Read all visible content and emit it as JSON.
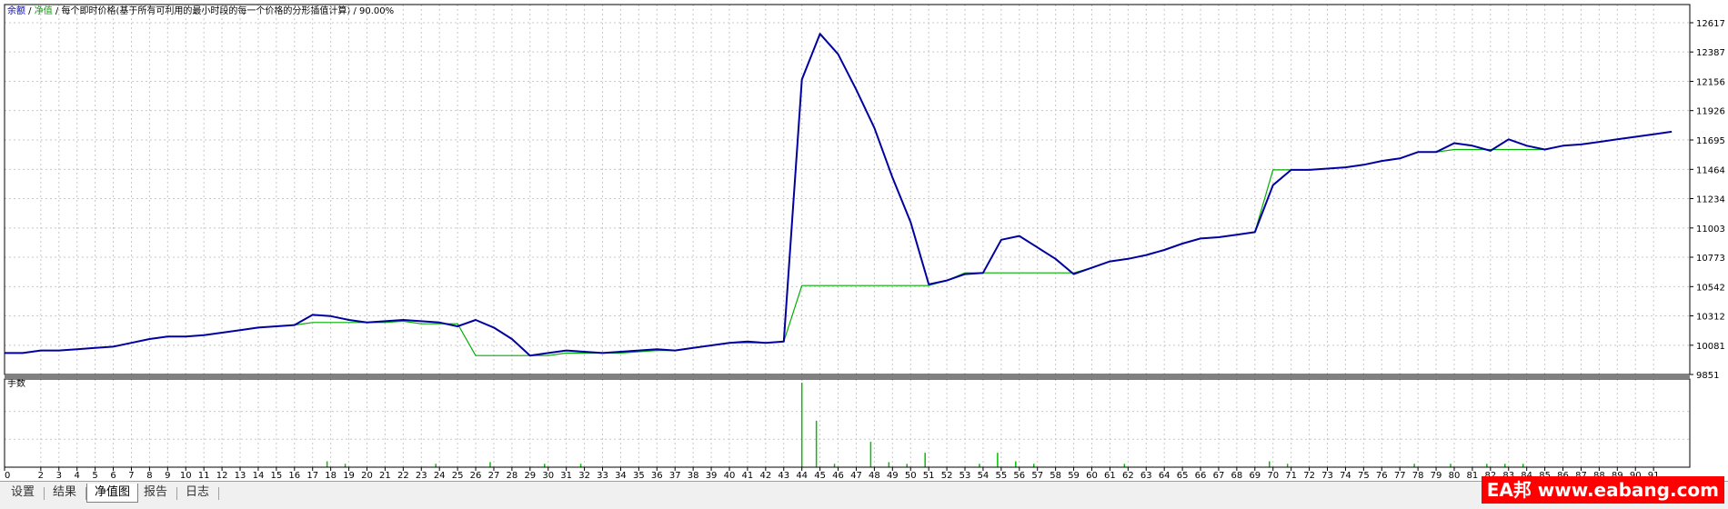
{
  "header": {
    "balance_label": "余额",
    "sep1": " / ",
    "equity_label": "净值",
    "sep2": " / ",
    "model_desc": "每个即时价格(基于所有可利用的最小时段的每一个价格的分形插值计算)",
    "sep3": " / ",
    "quality": "90.00%"
  },
  "tabs": [
    {
      "label": "设置"
    },
    {
      "label": "结果"
    },
    {
      "label": "净值图"
    },
    {
      "label": "报告"
    },
    {
      "label": "日志"
    }
  ],
  "watermark": "EA邦 www.eabang.com",
  "colors": {
    "equity": "#0000a0",
    "balance": "#00b000",
    "volume": "#00c000",
    "grid": "#c8c8c8",
    "separator": "#808080"
  },
  "chart_data": [
    {
      "type": "line",
      "title": "",
      "ylim": [
        9851,
        12617
      ],
      "y_ticks": [
        12617,
        12387,
        12156,
        11926,
        11695,
        11464,
        11234,
        11003,
        10773,
        10542,
        10312,
        10081,
        9851
      ],
      "x_ticks": [
        0,
        2,
        3,
        4,
        5,
        6,
        7,
        8,
        9,
        10,
        11,
        12,
        13,
        14,
        15,
        16,
        17,
        18,
        19,
        20,
        21,
        22,
        23,
        24,
        25,
        26,
        27,
        28,
        29,
        30,
        31,
        32,
        33,
        34,
        35,
        36,
        37,
        38,
        39,
        40,
        41,
        42,
        43,
        44,
        45,
        46,
        47,
        48,
        49,
        50,
        51,
        52,
        53,
        54,
        55,
        56,
        57,
        58,
        59,
        60,
        61,
        62,
        63,
        64,
        65,
        66,
        67,
        68,
        69,
        70,
        71,
        72,
        73,
        74,
        75,
        76,
        77,
        78,
        79,
        80,
        81,
        82,
        83,
        84,
        85,
        86,
        87,
        88,
        89,
        90,
        91
      ],
      "x_tick_labels": [
        "0",
        "2",
        "3",
        "4",
        "5",
        "6",
        "7",
        "8",
        "9",
        "10",
        "11",
        "12",
        "13",
        "14",
        "15",
        "16",
        "17",
        "18",
        "19",
        "20",
        "21",
        "22",
        "23",
        "24",
        "25",
        "26",
        "27",
        "28",
        "29",
        "30",
        "31",
        "32",
        "33",
        "34",
        "35",
        "36",
        "37",
        "38",
        "39",
        "40",
        "41",
        "42",
        "43",
        "44",
        "45",
        "46",
        "47",
        "48",
        "49",
        "50",
        "51",
        "52",
        "53",
        "54",
        "55",
        "56",
        "57",
        "58",
        "59",
        "60",
        "61",
        "62",
        "63",
        "64",
        "65",
        "66",
        "67",
        "68",
        "69",
        "70",
        "71",
        "72",
        "73",
        "74",
        "75",
        "76",
        "77",
        "78",
        "79",
        "80",
        "81",
        "82",
        "83",
        "84",
        "85",
        "86",
        "87",
        "88",
        "89",
        "90",
        "91"
      ],
      "xlim": [
        0,
        93
      ],
      "series": [
        {
          "name": "净值",
          "color": "#0000a0",
          "points": [
            [
              0,
              10020
            ],
            [
              1,
              10020
            ],
            [
              2,
              10040
            ],
            [
              3,
              10040
            ],
            [
              4,
              10050
            ],
            [
              5,
              10060
            ],
            [
              6,
              10070
            ],
            [
              7,
              10100
            ],
            [
              8,
              10130
            ],
            [
              9,
              10150
            ],
            [
              10,
              10150
            ],
            [
              11,
              10160
            ],
            [
              12,
              10180
            ],
            [
              13,
              10200
            ],
            [
              14,
              10220
            ],
            [
              15,
              10230
            ],
            [
              16,
              10240
            ],
            [
              17,
              10320
            ],
            [
              18,
              10310
            ],
            [
              19,
              10280
            ],
            [
              20,
              10260
            ],
            [
              21,
              10270
            ],
            [
              22,
              10280
            ],
            [
              23,
              10270
            ],
            [
              24,
              10260
            ],
            [
              25,
              10230
            ],
            [
              26,
              10280
            ],
            [
              27,
              10220
            ],
            [
              28,
              10130
            ],
            [
              29,
              10000
            ],
            [
              30,
              10020
            ],
            [
              31,
              10040
            ],
            [
              32,
              10030
            ],
            [
              33,
              10020
            ],
            [
              34,
              10030
            ],
            [
              35,
              10040
            ],
            [
              36,
              10050
            ],
            [
              37,
              10040
            ],
            [
              38,
              10060
            ],
            [
              39,
              10080
            ],
            [
              40,
              10100
            ],
            [
              41,
              10110
            ],
            [
              42,
              10100
            ],
            [
              43,
              10110
            ],
            [
              44,
              12170
            ],
            [
              45,
              12530
            ],
            [
              46,
              12370
            ],
            [
              47,
              12090
            ],
            [
              48,
              11790
            ],
            [
              49,
              11400
            ],
            [
              50,
              11050
            ],
            [
              51,
              10560
            ],
            [
              52,
              10590
            ],
            [
              53,
              10640
            ],
            [
              54,
              10650
            ],
            [
              55,
              10910
            ],
            [
              56,
              10940
            ],
            [
              57,
              10850
            ],
            [
              58,
              10760
            ],
            [
              59,
              10640
            ],
            [
              60,
              10690
            ],
            [
              61,
              10740
            ],
            [
              62,
              10760
            ],
            [
              63,
              10790
            ],
            [
              64,
              10830
            ],
            [
              65,
              10880
            ],
            [
              66,
              10920
            ],
            [
              67,
              10930
            ],
            [
              68,
              10950
            ],
            [
              69,
              10970
            ],
            [
              70,
              11340
            ],
            [
              71,
              11460
            ],
            [
              72,
              11460
            ],
            [
              73,
              11470
            ],
            [
              74,
              11480
            ],
            [
              75,
              11500
            ],
            [
              76,
              11530
            ],
            [
              77,
              11550
            ],
            [
              78,
              11600
            ],
            [
              79,
              11600
            ],
            [
              80,
              11670
            ],
            [
              81,
              11650
            ],
            [
              82,
              11610
            ],
            [
              83,
              11700
            ],
            [
              84,
              11650
            ],
            [
              85,
              11620
            ],
            [
              86,
              11650
            ],
            [
              87,
              11660
            ],
            [
              88,
              11680
            ],
            [
              89,
              11700
            ],
            [
              90,
              11720
            ],
            [
              91,
              11740
            ],
            [
              92,
              11760
            ]
          ]
        },
        {
          "name": "余额",
          "color": "#00b000",
          "points": [
            [
              0,
              10020
            ],
            [
              1,
              10020
            ],
            [
              2,
              10040
            ],
            [
              3,
              10040
            ],
            [
              4,
              10050
            ],
            [
              5,
              10060
            ],
            [
              6,
              10070
            ],
            [
              7,
              10100
            ],
            [
              8,
              10130
            ],
            [
              9,
              10150
            ],
            [
              10,
              10150
            ],
            [
              11,
              10160
            ],
            [
              12,
              10180
            ],
            [
              13,
              10200
            ],
            [
              14,
              10220
            ],
            [
              15,
              10230
            ],
            [
              16,
              10240
            ],
            [
              17,
              10260
            ],
            [
              18,
              10260
            ],
            [
              19,
              10260
            ],
            [
              20,
              10260
            ],
            [
              21,
              10260
            ],
            [
              22,
              10270
            ],
            [
              23,
              10250
            ],
            [
              24,
              10250
            ],
            [
              25,
              10250
            ],
            [
              26,
              10000
            ],
            [
              27,
              10000
            ],
            [
              28,
              10000
            ],
            [
              29,
              10000
            ],
            [
              30,
              10000
            ],
            [
              31,
              10020
            ],
            [
              32,
              10020
            ],
            [
              33,
              10020
            ],
            [
              34,
              10020
            ],
            [
              35,
              10030
            ],
            [
              36,
              10040
            ],
            [
              37,
              10040
            ],
            [
              38,
              10060
            ],
            [
              39,
              10080
            ],
            [
              40,
              10100
            ],
            [
              41,
              10100
            ],
            [
              42,
              10100
            ],
            [
              43,
              10110
            ],
            [
              44,
              10550
            ],
            [
              45,
              10550
            ],
            [
              46,
              10550
            ],
            [
              47,
              10550
            ],
            [
              48,
              10550
            ],
            [
              49,
              10550
            ],
            [
              50,
              10550
            ],
            [
              51,
              10550
            ],
            [
              52,
              10590
            ],
            [
              53,
              10650
            ],
            [
              54,
              10650
            ],
            [
              55,
              10650
            ],
            [
              56,
              10650
            ],
            [
              57,
              10650
            ],
            [
              58,
              10650
            ],
            [
              59,
              10650
            ],
            [
              60,
              10690
            ],
            [
              61,
              10740
            ],
            [
              62,
              10760
            ],
            [
              63,
              10790
            ],
            [
              64,
              10830
            ],
            [
              65,
              10880
            ],
            [
              66,
              10920
            ],
            [
              67,
              10930
            ],
            [
              68,
              10950
            ],
            [
              69,
              10970
            ],
            [
              70,
              11460
            ],
            [
              71,
              11460
            ],
            [
              72,
              11460
            ],
            [
              73,
              11470
            ],
            [
              74,
              11480
            ],
            [
              75,
              11500
            ],
            [
              76,
              11530
            ],
            [
              77,
              11550
            ],
            [
              78,
              11600
            ],
            [
              79,
              11600
            ],
            [
              80,
              11620
            ],
            [
              81,
              11620
            ],
            [
              82,
              11620
            ],
            [
              83,
              11620
            ],
            [
              84,
              11620
            ],
            [
              85,
              11620
            ],
            [
              86,
              11650
            ],
            [
              87,
              11660
            ],
            [
              88,
              11680
            ],
            [
              89,
              11700
            ],
            [
              90,
              11720
            ],
            [
              91,
              11740
            ],
            [
              92,
              11760
            ]
          ]
        }
      ]
    },
    {
      "type": "bar",
      "title": "手数",
      "ylim": [
        0,
        1
      ],
      "xlim": [
        0,
        93
      ],
      "bars": [
        [
          17.8,
          0.07
        ],
        [
          18.8,
          0.04
        ],
        [
          23.8,
          0.04
        ],
        [
          26.8,
          0.06
        ],
        [
          29.8,
          0.04
        ],
        [
          31.8,
          0.04
        ],
        [
          44,
          1.0
        ],
        [
          44.8,
          0.55
        ],
        [
          45.8,
          0.04
        ],
        [
          47.8,
          0.3
        ],
        [
          48.8,
          0.06
        ],
        [
          49.8,
          0.04
        ],
        [
          50.8,
          0.17
        ],
        [
          53.8,
          0.04
        ],
        [
          54.8,
          0.17
        ],
        [
          55.8,
          0.07
        ],
        [
          56.8,
          0.04
        ],
        [
          61.8,
          0.04
        ],
        [
          69.8,
          0.07
        ],
        [
          70.8,
          0.04
        ],
        [
          77.8,
          0.04
        ],
        [
          79.8,
          0.04
        ],
        [
          81.8,
          0.04
        ],
        [
          82.8,
          0.04
        ],
        [
          83.8,
          0.04
        ]
      ]
    }
  ]
}
